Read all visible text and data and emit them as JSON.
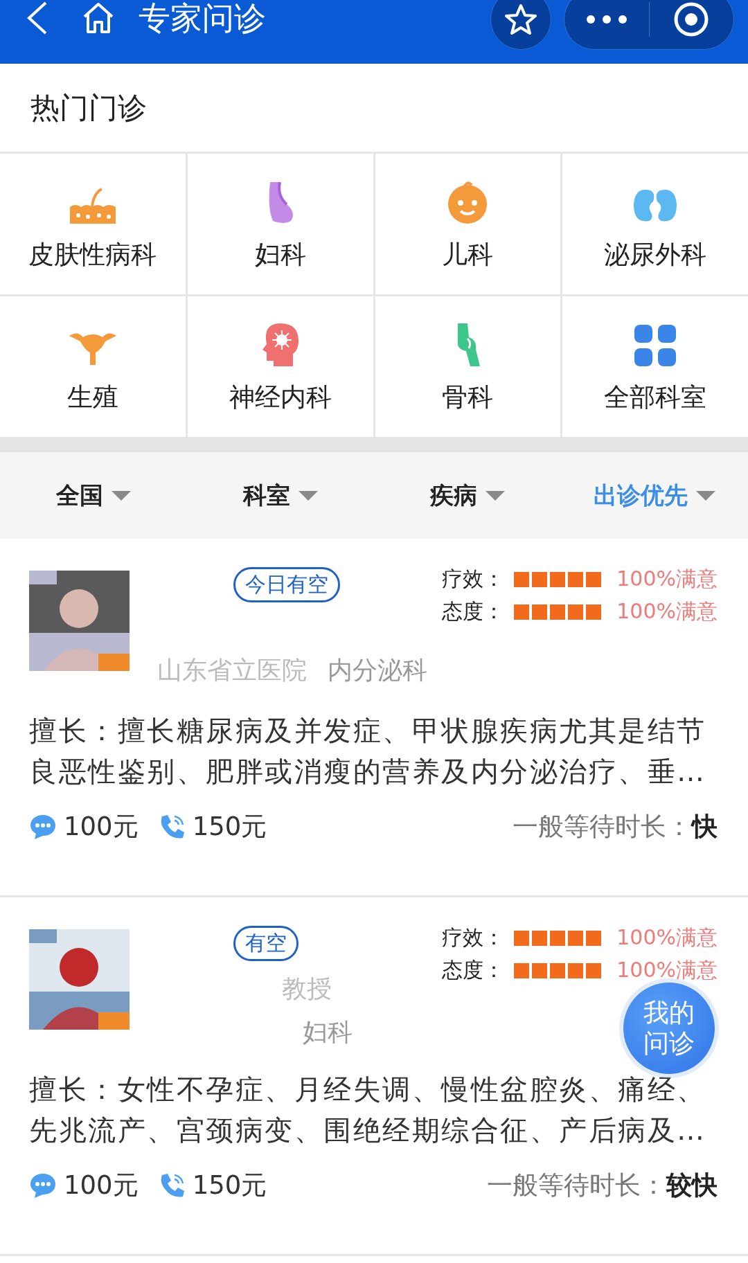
{
  "top_bar": {
    "title": "专家问诊"
  },
  "hot_section": {
    "title": "热门门诊",
    "departments": [
      {
        "label": "皮肤性病科",
        "kind": "skin"
      },
      {
        "label": "妇科",
        "kind": "gyn"
      },
      {
        "label": "儿科",
        "kind": "child"
      },
      {
        "label": "泌尿外科",
        "kind": "kidney"
      },
      {
        "label": "生殖",
        "kind": "uterus"
      },
      {
        "label": "神经内科",
        "kind": "brain"
      },
      {
        "label": "骨科",
        "kind": "bone"
      },
      {
        "label": "全部科室",
        "kind": "all"
      }
    ]
  },
  "filters": [
    {
      "label": "全国",
      "selected": false
    },
    {
      "label": "科室",
      "selected": false
    },
    {
      "label": "疾病",
      "selected": false
    },
    {
      "label": "出诊优先",
      "selected": true
    }
  ],
  "doctors": [
    {
      "badge": "今日有空",
      "hospital": "山东省立医院",
      "department": "内分泌科",
      "ratings": [
        {
          "label": "疗效：",
          "stars": 5,
          "reading": "100%满意"
        },
        {
          "label": "态度：",
          "stars": 5,
          "reading": "100%满意"
        }
      ],
      "specialty": "擅长：擅长糖尿病及并发症、甲状腺疾病尤其是结节良恶性鉴别、肥胖或消瘦的营养及内分泌治疗、垂…",
      "text_price": "100元",
      "phone_price": "150元",
      "wait_label": "一般等待时长：",
      "wait_value": "快"
    },
    {
      "badge": "有空",
      "title": "教授",
      "department": "妇科",
      "ratings": [
        {
          "label": "疗效：",
          "stars": 5,
          "reading": "100%满意"
        },
        {
          "label": "态度：",
          "stars": 5,
          "reading": "100%满意"
        }
      ],
      "specialty": "擅长：女性不孕症、月经失调、慢性盆腔炎、痛经、先兆流产、宫颈病变、围绝经期综合征、产后病及…",
      "text_price": "100元",
      "phone_price": "150元",
      "wait_label": "一般等待时长：",
      "wait_value": "较快"
    }
  ],
  "floating_button": {
    "label": "我的问诊"
  }
}
